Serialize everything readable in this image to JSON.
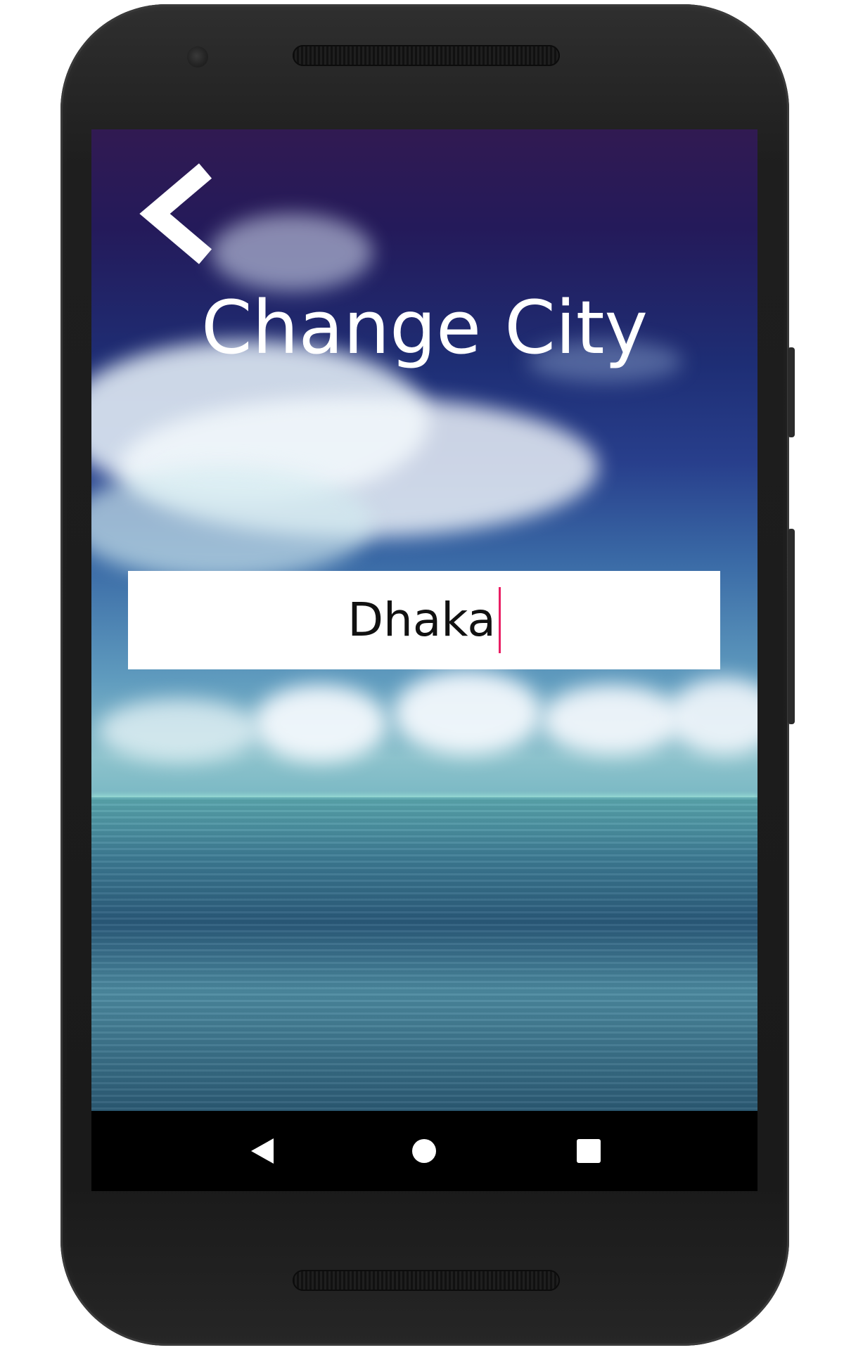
{
  "screen": {
    "title": "Change City",
    "city_input": {
      "value": "Dhaka",
      "caret_color": "#e91e63"
    },
    "back_icon": "chevron-left-icon"
  },
  "system_nav": {
    "items": [
      {
        "icon": "nav-back-icon"
      },
      {
        "icon": "nav-home-icon"
      },
      {
        "icon": "nav-recents-icon"
      }
    ]
  }
}
